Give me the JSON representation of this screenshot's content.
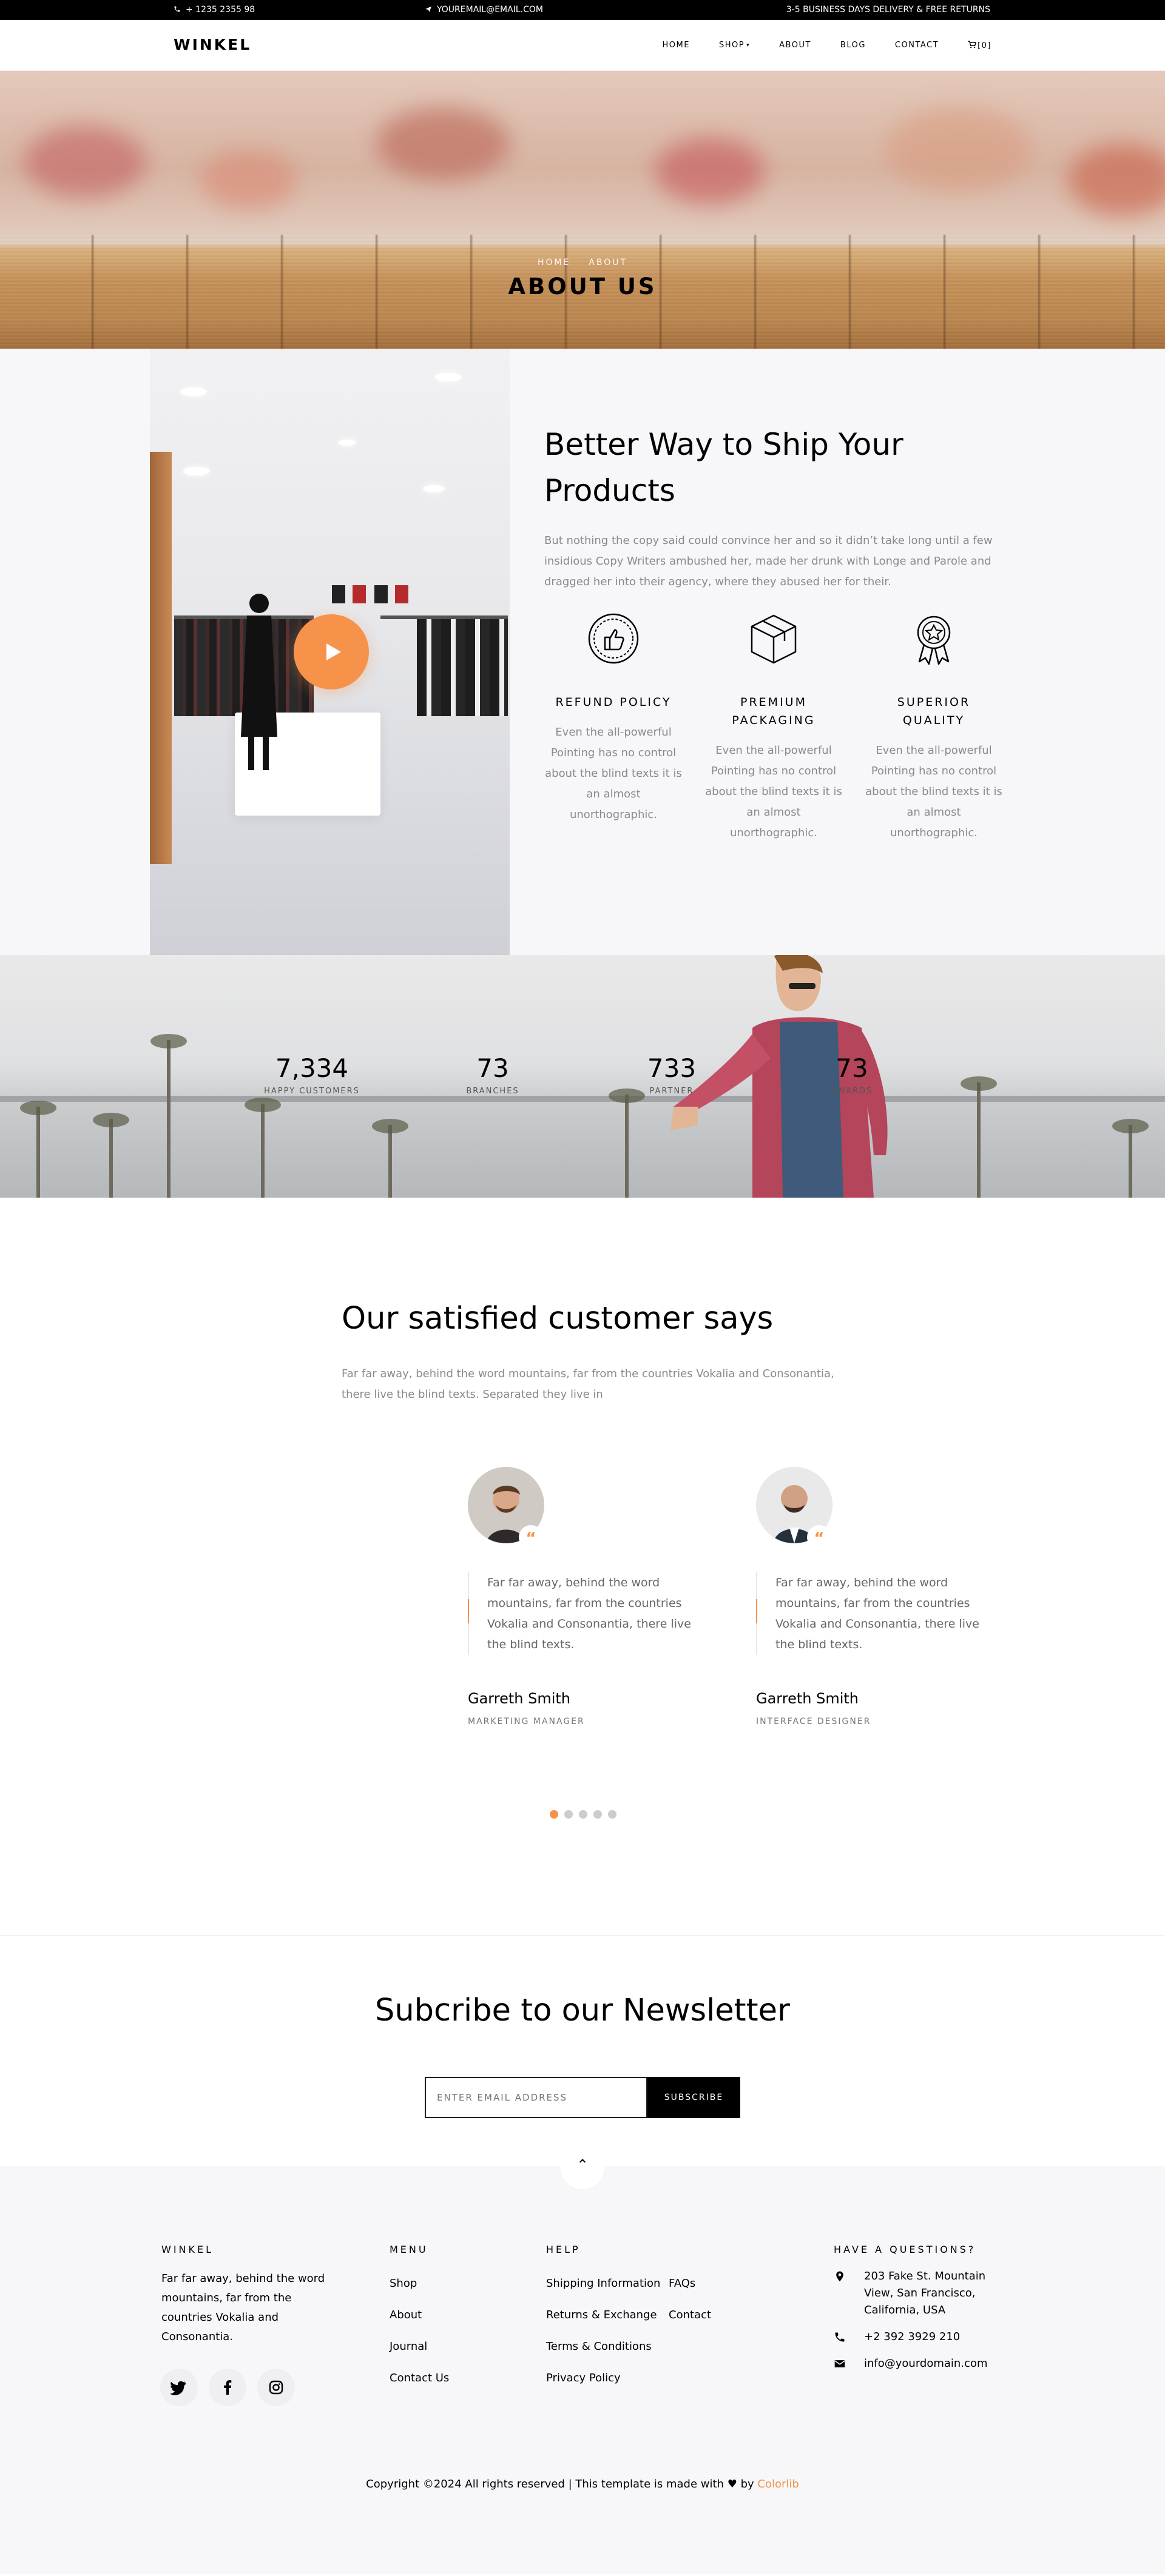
{
  "topbar": {
    "phone": "+ 1235 2355 98",
    "email": "YOUREMAIL@EMAIL.COM",
    "delivery": "3-5 BUSINESS DAYS DELIVERY & FREE RETURNS"
  },
  "nav": {
    "brand": "WINKEL",
    "items": [
      "HOME",
      "SHOP",
      "ABOUT",
      "BLOG",
      "CONTACT"
    ],
    "cart": "[0]"
  },
  "hero": {
    "breadcrumb_home": "HOME",
    "breadcrumb_current": "ABOUT",
    "title": "ABOUT US"
  },
  "about": {
    "heading": "Better Way to Ship Your Products",
    "lead": "But nothing the copy said could convince her and so it didn’t take long until a few insidious Copy Writers ambushed her, made her drunk with Longe and Parole and dragged her into their agency, where they abused her for their.",
    "features": [
      {
        "icon": "thumbs-up-badge-icon",
        "title": "REFUND POLICY",
        "text": "Even the all-powerful Pointing has no control about the blind texts it is an almost unorthographic."
      },
      {
        "icon": "box-icon",
        "title": "PREMIUM PACKAGING",
        "text": "Even the all-powerful Pointing has no control about the blind texts it is an almost unorthographic."
      },
      {
        "icon": "award-ribbon-icon",
        "title": "SUPERIOR QUALITY",
        "text": "Even the all-powerful Pointing has no control about the blind texts it is an almost unorthographic."
      }
    ]
  },
  "stats": [
    {
      "value": "7,334",
      "label": "HAPPY CUSTOMERS"
    },
    {
      "value": "73",
      "label": "BRANCHES"
    },
    {
      "value": "733",
      "label": "PARTNER"
    },
    {
      "value": "73",
      "label": "AWARDS"
    }
  ],
  "testimonials": {
    "heading": "Our satisfied customer says",
    "subtitle": "Far far away, behind the word mountains, far from the countries Vokalia and Consonantia, there live the blind texts. Separated they live in",
    "items": [
      {
        "quote": "Far far away, behind the word mountains, far from the countries Vokalia and Consonantia, there live the blind texts.",
        "name": "Garreth Smith",
        "role": "MARKETING MANAGER"
      },
      {
        "quote": "Far far away, behind the word mountains, far from the countries Vokalia and Consonantia, there live the blind texts.",
        "name": "Garreth Smith",
        "role": "INTERFACE DESIGNER"
      }
    ],
    "quote_mark": "“",
    "dots": 5
  },
  "newsletter": {
    "heading": "Subcribe to our Newsletter",
    "placeholder": "ENTER EMAIL ADDRESS",
    "button": "SUBSCRIBE"
  },
  "footer": {
    "brand": "WINKEL",
    "about": "Far far away, behind the word mountains, far from the countries Vokalia and Consonantia.",
    "menu_title": "MENU",
    "menu": [
      "Shop",
      "About",
      "Journal",
      "Contact Us"
    ],
    "help_title": "HELP",
    "help_col1": [
      "Shipping Information",
      "Returns & Exchange",
      "Terms & Conditions",
      "Privacy Policy"
    ],
    "help_col2": [
      "FAQs",
      "Contact"
    ],
    "contact_title": "HAVE A QUESTIONS?",
    "address": "203 Fake St. Mountain View, San Francisco, California, USA",
    "phone": "+2 392 3929 210",
    "email": "info@yourdomain.com",
    "copyright_pre": "Copyright ©2024 All rights reserved | This template is made with",
    "copyright_by": "by",
    "copyright_link": "Colorlib",
    "social": [
      "twitter-icon",
      "facebook-icon",
      "instagram-icon"
    ]
  },
  "colors": {
    "accent": "#f6924a",
    "dark": "#000000",
    "muted": "#8a8a8a",
    "section_bg": "#f7f6f9"
  }
}
